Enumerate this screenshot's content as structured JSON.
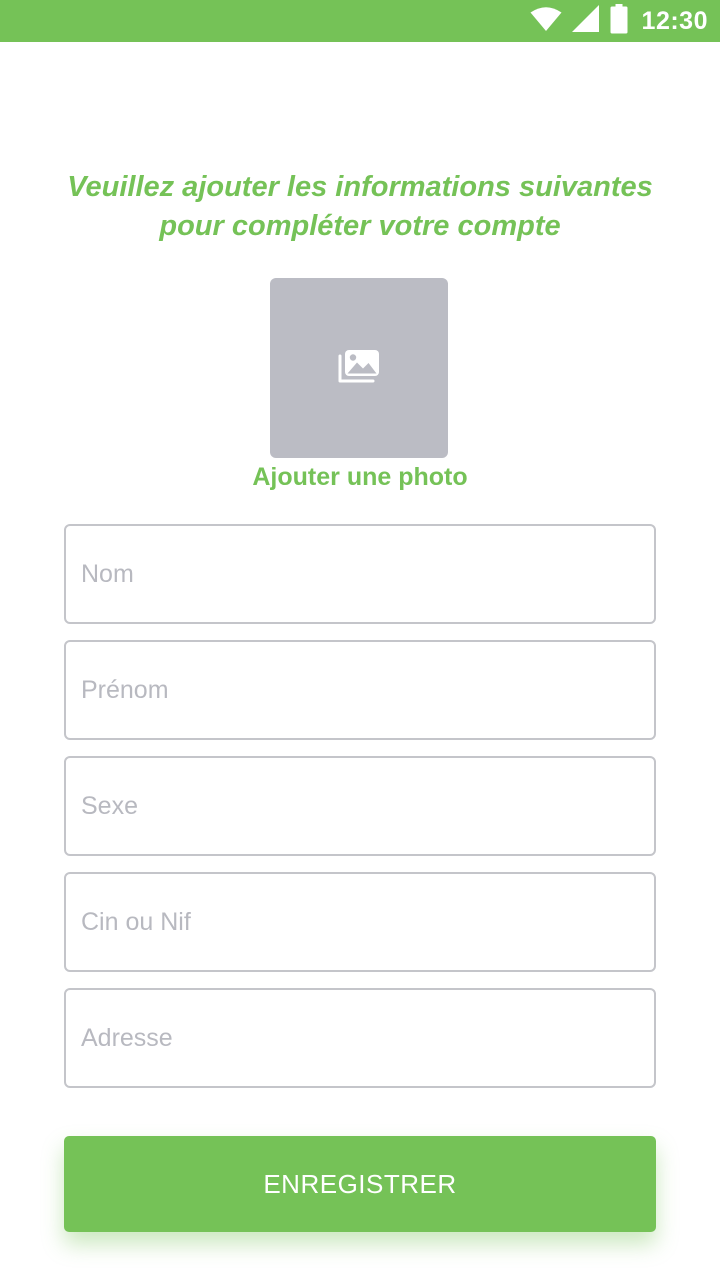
{
  "status_bar": {
    "time": "12:30",
    "icons": [
      "wifi-icon",
      "signal-icon",
      "battery-icon"
    ],
    "background": "#75c257"
  },
  "header": {
    "line1": "Veuillez ajouter les informations suivantes",
    "line2": "pour compléter votre compte"
  },
  "photo": {
    "icon": "image-gallery-icon",
    "label": "Ajouter une photo"
  },
  "form": {
    "fields": [
      {
        "name": "nom",
        "placeholder": "Nom",
        "value": ""
      },
      {
        "name": "prenom",
        "placeholder": "Prénom",
        "value": ""
      },
      {
        "name": "sexe",
        "placeholder": "Sexe",
        "value": ""
      },
      {
        "name": "cin-nif",
        "placeholder": "Cin ou Nif",
        "value": ""
      },
      {
        "name": "adresse",
        "placeholder": "Adresse",
        "value": ""
      }
    ]
  },
  "actions": {
    "save_label": "ENREGISTRER"
  },
  "colors": {
    "accent": "#75c257",
    "placeholder": "#b8b9c0",
    "photo_background": "#bbbcc4",
    "field_border": "#c4c5ca"
  }
}
